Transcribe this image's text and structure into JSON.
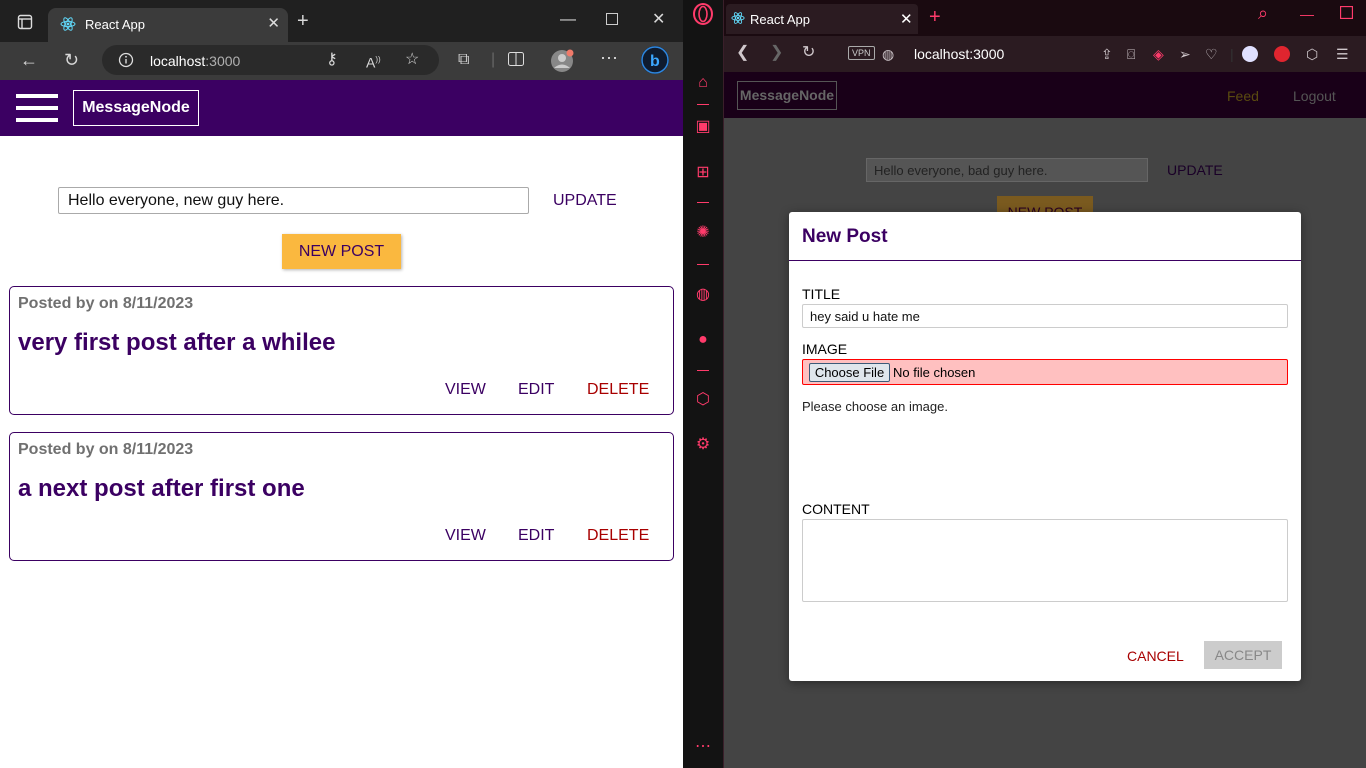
{
  "left_browser": {
    "tab_title": "React App",
    "url_host": "localhost",
    "url_port": ":3000",
    "icons": [
      "tab-actions-icon",
      "react-icon",
      "close-icon",
      "new-tab-icon",
      "minimize-icon",
      "maximize-icon",
      "window-close-icon",
      "back-icon",
      "refresh-icon",
      "info-icon",
      "key-icon",
      "read-aloud-icon",
      "favorite-icon",
      "extensions-icon",
      "split-screen-icon",
      "profile-icon",
      "more-icon",
      "bing-icon"
    ],
    "app": {
      "logo": "MessageNode",
      "status_value": "Hello everyone, new guy here.",
      "update_label": "UPDATE",
      "new_post_label": "NEW POST",
      "posts": [
        {
          "meta": "Posted by on 8/11/2023",
          "title": "very first post after a whilee",
          "view": "VIEW",
          "edit": "EDIT",
          "delete": "DELETE"
        },
        {
          "meta": "Posted by on 8/11/2023",
          "title": "a next post after first one",
          "view": "VIEW",
          "edit": "EDIT",
          "delete": "DELETE"
        }
      ]
    },
    "colors": {
      "brand": "#3b0062",
      "accent": "#fab83f",
      "danger": "#a80000"
    }
  },
  "right_browser": {
    "tab_title": "React App",
    "vpn_label": "VPN",
    "url": "localhost:3000",
    "app": {
      "logo": "MessageNode",
      "nav_feed": "Feed",
      "nav_logout": "Logout",
      "status_value": "Hello everyone, bad guy here.",
      "update_label": "UPDATE",
      "new_post_label": "NEW POST"
    },
    "modal": {
      "title": "New Post",
      "title_label": "TITLE",
      "title_value": "hey said u hate me",
      "image_label": "IMAGE",
      "choose_file": "Choose File",
      "no_file": "No file chosen",
      "image_hint": "Please choose an image.",
      "content_label": "CONTENT",
      "cancel": "CANCEL",
      "accept": "ACCEPT"
    },
    "sidebar_more": "⋯",
    "colors": {
      "gx_accent": "#ff3b6b"
    }
  }
}
